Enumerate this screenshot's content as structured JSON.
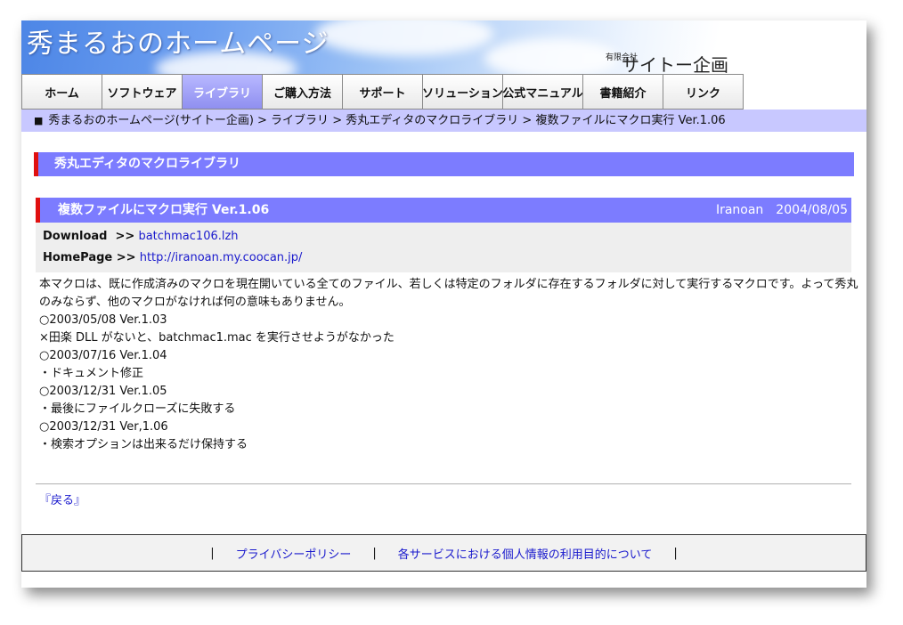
{
  "header": {
    "site_title": "秀まるおのホームページ",
    "company_kind": "有限会社",
    "company_name": "サイトー企画"
  },
  "nav": {
    "items": [
      {
        "label": "ホーム"
      },
      {
        "label": "ソフトウェア"
      },
      {
        "label": "ライブラリ",
        "active": true
      },
      {
        "label": "ご購入方法"
      },
      {
        "label": "サポート"
      },
      {
        "label": "ソリューション"
      },
      {
        "label": "公式マニュアル"
      },
      {
        "label": "書籍紹介"
      },
      {
        "label": "リンク"
      }
    ]
  },
  "breadcrumb": {
    "bullet": "■",
    "text": "秀まるおのホームページ(サイトー企画) > ライブラリ > 秀丸エディタのマクロライブラリ > 複数ファイルにマクロ実行 Ver.1.06"
  },
  "section": {
    "title": "秀丸エディタのマクロライブラリ"
  },
  "entry": {
    "title": "複数ファイルにマクロ実行 Ver.1.06",
    "author": "Iranoan",
    "date": "2004/08/05",
    "download_label": "Download  >>",
    "download_link": "batchmac106.lzh",
    "homepage_label": "HomePage >>",
    "homepage_link": "http://iranoan.my.coocan.jp/",
    "description_lines": [
      "本マクロは、既に作成済みのマクロを現在開いている全てのファイル、若しくは特定のフォルダに存在するフォルダに対して実行するマクロです。よって秀丸のみならず、他のマクロがなければ何の意味もありません。",
      "○2003/05/08 Ver.1.03",
      "×田楽 DLL がないと、batchmac1.mac を実行させようがなかった",
      "○2003/07/16 Ver.1.04",
      "・ドキュメント修正",
      "○2003/12/31 Ver.1.05",
      "・最後にファイルクローズに失敗する",
      "○2003/12/31 Ver,1.06",
      "・検索オプションは出来るだけ保持する"
    ]
  },
  "back_link": "『戻る』",
  "footer": {
    "sep": "|",
    "privacy": "プライバシーポリシー",
    "purpose": "各サービスにおける個人情報の利用目的について"
  },
  "colors": {
    "nav_active": "#8f8ff0",
    "heading_bg": "#7c7cff",
    "heading_accent": "#e01010",
    "breadcrumb_bg": "#c8c8ff",
    "link": "#1a1acd"
  }
}
